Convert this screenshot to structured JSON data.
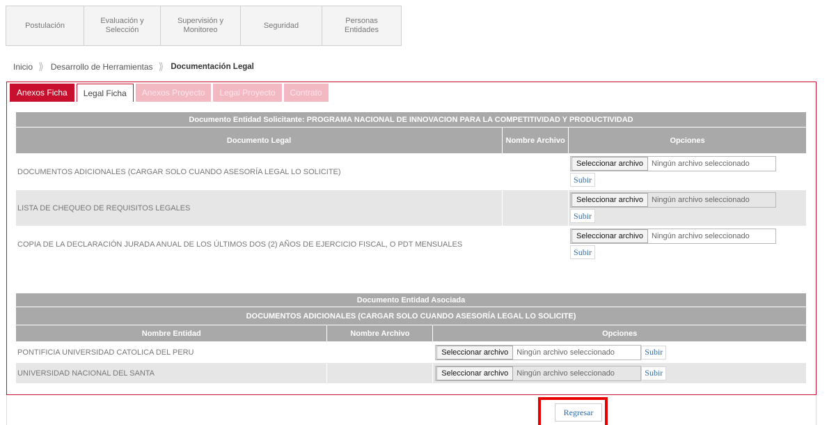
{
  "nav": [
    "Postulación",
    "Evaluación y Selección",
    "Supervisión y Monitoreo",
    "Seguridad",
    "Personas Entidades"
  ],
  "breadcrumb": {
    "home": "Inicio",
    "section": "Desarrollo de Herramientas",
    "current": "Documentación Legal"
  },
  "tabs": [
    "Anexos Ficha",
    "Legal Ficha",
    "Anexos Proyecto",
    "Legal Proyecto",
    "Contrato"
  ],
  "doc_table": {
    "title": "Documento Entidad Solicitante: PROGRAMA NACIONAL DE INNOVACION PARA LA COMPETITIVIDAD Y PRODUCTIVIDAD",
    "headers": [
      "Documento Legal",
      "Nombre Archivo",
      "Opciones"
    ],
    "rows": [
      "DOCUMENTOS ADICIONALES (CARGAR SOLO CUANDO ASESORÍA LEGAL LO SOLICITE)",
      "LISTA DE CHEQUEO DE REQUISITOS LEGALES",
      "COPIA DE LA DECLARACIÓN JURADA ANUAL DE LOS ÚLTIMOS DOS (2) AÑOS DE EJERCICIO FISCAL, O PDT MENSUALES"
    ]
  },
  "assoc_table": {
    "title": "Documento Entidad Asociada",
    "subtitle": "DOCUMENTOS ADICIONALES (CARGAR SOLO CUANDO ASESORÍA LEGAL LO SOLICITE)",
    "headers": [
      "Nombre Entidad",
      "Nombre Archivo",
      "Opciones"
    ],
    "rows": [
      "PONTIFICIA UNIVERSIDAD CATOLICA DEL PERU",
      "UNIVERSIDAD NACIONAL DEL SANTA"
    ]
  },
  "file_input": {
    "button": "Seleccionar archivo",
    "status": "Ningún archivo seleccionado"
  },
  "upload_label": "Subir",
  "back_label": "Regresar",
  "colors": {
    "accent": "#c8102e",
    "tab_disabled": "#f3b9c3",
    "header_gray": "#a9a9a9",
    "link_blue": "#2a6db3",
    "highlight": "#e60000"
  }
}
